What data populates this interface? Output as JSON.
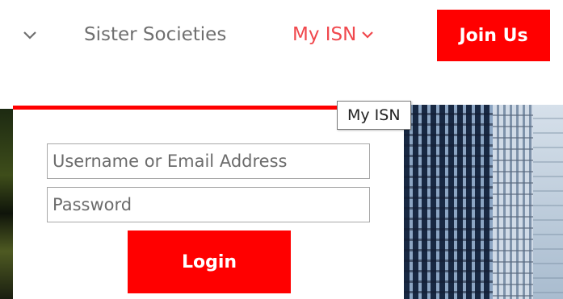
{
  "nav": {
    "dropdown_icon": "chevron-down-icon",
    "sister_societies": "Sister Societies",
    "my_isn": "My ISN",
    "my_isn_icon": "chevron-down-icon",
    "join_us": "Join Us"
  },
  "login": {
    "username_placeholder": "Username or Email Address",
    "username_value": "",
    "password_placeholder": "Password",
    "password_value": "",
    "login_label": "Login"
  },
  "tooltip": {
    "text": "My ISN"
  },
  "colors": {
    "accent": "#ff0000",
    "nav_active": "#f0484d",
    "nav_text": "#6f6f6f"
  }
}
